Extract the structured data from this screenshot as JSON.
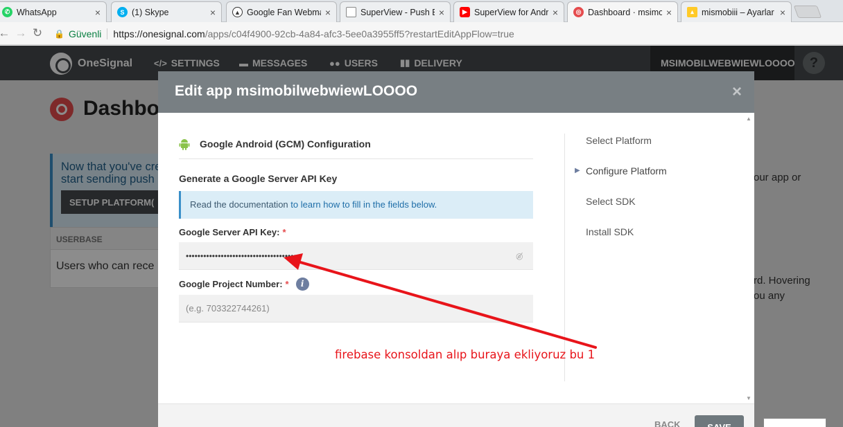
{
  "browser": {
    "tabs": [
      {
        "title": "WhatsApp",
        "icon": "whatsapp-icon",
        "color": "#25d366"
      },
      {
        "title": "(1) Skype",
        "icon": "skype-icon",
        "color": "#00aff0"
      },
      {
        "title": "Google Fan Webma",
        "icon": "google-fan-icon",
        "color": "#444444"
      },
      {
        "title": "SuperView - Push B",
        "icon": "document-icon",
        "color": "#888888"
      },
      {
        "title": "SuperView for Andr",
        "icon": "youtube-icon",
        "color": "#ff0000"
      },
      {
        "title": "Dashboard · msimo",
        "icon": "onesignal-icon",
        "color": "#e54b4d"
      },
      {
        "title": "mismobiii – Ayarlar",
        "icon": "firebase-icon",
        "color": "#ffca28"
      }
    ],
    "secure_label": "Güvenli",
    "url_host": "https://onesignal.com",
    "url_rest": "/apps/c04f4900-92cb-4a84-afc3-5ee0a3955ff5?restartEditAppFlow=true"
  },
  "appnav": {
    "brand": "OneSignal",
    "items": [
      {
        "label": "SETTINGS",
        "icon": "code-icon"
      },
      {
        "label": "MESSAGES",
        "icon": "messages-icon"
      },
      {
        "label": "USERS",
        "icon": "users-icon"
      },
      {
        "label": "DELIVERY",
        "icon": "bar-chart-icon"
      }
    ],
    "app_name": "MSIMOBILWEBWIEWLOOOO",
    "help": "?"
  },
  "dashboard": {
    "title": "Dashbo",
    "notice": "Now that you've cre start sending push",
    "notice_button": "SETUP PLATFORM(",
    "userbase_header": "USERBASE",
    "userbase_text": "Users who can rece",
    "right_text_1": "our app or",
    "right_text_2": "rd. Hovering",
    "right_text_3": "ou any"
  },
  "modal": {
    "title": "Edit app msimobilwebwiewLOOOO",
    "close": "×",
    "platform_label": "Google Android (GCM) Configuration",
    "section_title": "Generate a Google Server API Key",
    "info_text": "Read the documentation ",
    "info_link": "to learn how to fill in the fields below.",
    "api_key_label": "Google Server API Key:",
    "api_key_value": "••••••••••••••••••••••••••••••••••••••••",
    "project_number_label": "Google Project Number:",
    "project_number_placeholder": "(e.g. 703322744261)",
    "required_mark": "*",
    "info_icon": "i",
    "steps": [
      {
        "label": "Select Platform",
        "active": false
      },
      {
        "label": "Configure Platform",
        "active": true
      },
      {
        "label": "Select SDK",
        "active": false
      },
      {
        "label": "Install SDK",
        "active": false
      }
    ],
    "back_label": "BACK",
    "save_label": "SAVE"
  },
  "annotation": {
    "text": "firebase konsoldan alıp buraya ekliyoruz bu 1",
    "color": "#e8141a"
  }
}
